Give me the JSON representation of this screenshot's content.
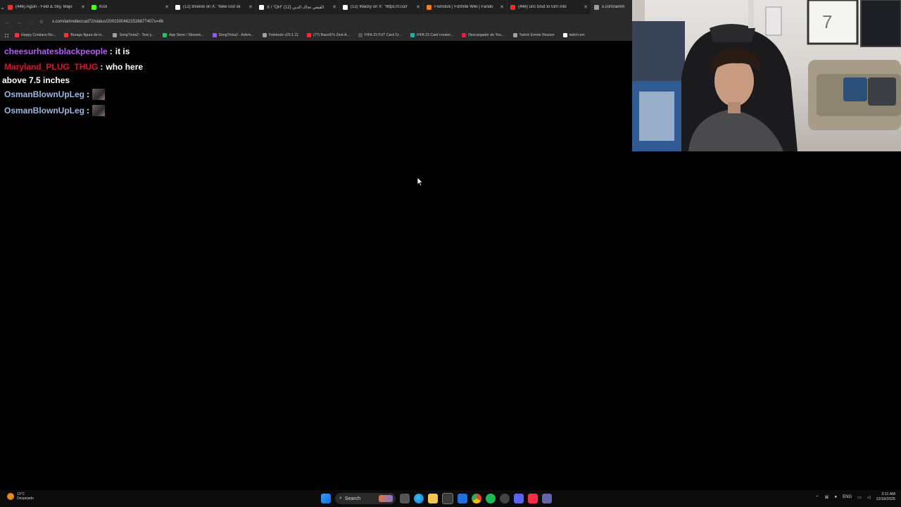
{
  "browser": {
    "tabs": [
      {
        "title": "(446) Agsin - Feid & Sky, Majo",
        "fav": "youtube-icon",
        "color": "#ff2a2a"
      },
      {
        "title": "Kick",
        "fav": "kick-icon",
        "color": "#53fc18"
      },
      {
        "title": "(12) 8Seloe on X: \"New cod sk",
        "fav": "x-icon",
        "color": "#ffffff"
      },
      {
        "title": "X / \"OH\" (12) القيفي تجاك الدين",
        "fav": "x-icon",
        "color": "#ffffff"
      },
      {
        "title": "(12) Wacky on X: \"https://t.co/r",
        "fav": "x-icon",
        "color": "#ffffff"
      },
      {
        "title": "Fishstick | Fortnite Wiki | Fando",
        "fav": "fandom-icon",
        "color": "#fa7a20"
      },
      {
        "title": "(446) unc bout to turn into",
        "fav": "youtube-icon",
        "color": "#ff2a2a"
      },
      {
        "title": "x.com/iamm",
        "fav": "globe-icon",
        "color": "#9aa0a6"
      }
    ],
    "url": "x.com/iamrebeccad72/status/20015004622526877407s=46",
    "bookmarks": [
      {
        "label": "Happy Cristiano Ro...",
        "color": "#ff3030"
      },
      {
        "label": "Burago figura de lo...",
        "color": "#ff3030"
      },
      {
        "label": "SongTrivia2 - Test y...",
        "color": "#9aa0a6"
      },
      {
        "label": "App Store / Streami...",
        "color": "#22c55e"
      },
      {
        "label": "SongTrivia2 - Adivin...",
        "color": "#8b5cf6"
      },
      {
        "label": "Feletools v25.1.11",
        "color": "#9aa0a6"
      },
      {
        "label": "(77) Razo97s Zest-A...",
        "color": "#ff2a2a"
      },
      {
        "label": "FIFA 23 FUT Card Cr...",
        "color": "#555555"
      },
      {
        "label": "FIFA 23 Card creator...",
        "color": "#20b2aa"
      },
      {
        "label": "Descargador de You...",
        "color": "#e11d48"
      },
      {
        "label": "Twitch Emote Resizer",
        "color": "#9aa0a6"
      },
      {
        "label": "twitch em",
        "color": "#ffffff"
      }
    ]
  },
  "chat": [
    {
      "user": "cheesurhatesblackpeople",
      "text": "it is",
      "color": "#b15cff"
    },
    {
      "user": "Maryland_PLUG_THUG",
      "text": "who here",
      "color": "#e0112b"
    },
    {
      "user": "",
      "text": "above 7.5 inches",
      "color": "#ffffff"
    },
    {
      "user": "OsmanBlownUpLeg",
      "text": "",
      "color": "#9bb7e0",
      "emote": true
    },
    {
      "user": "OsmanBlownUpLeg",
      "text": "",
      "color": "#9bb7e0",
      "emote": true
    }
  ],
  "taskbar": {
    "weather_temp": "13°C",
    "weather_desc": "Despejado",
    "search_label": "Search",
    "lang": "ENG",
    "time": "3:11 AM",
    "date": "12/18/2025"
  }
}
